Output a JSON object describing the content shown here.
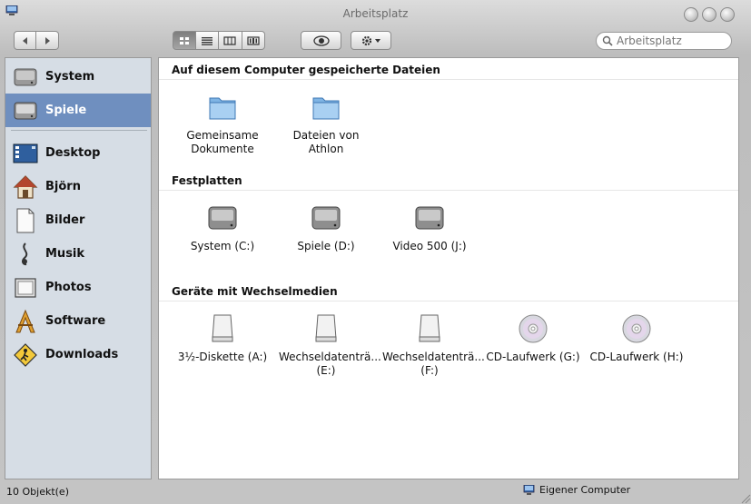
{
  "window": {
    "title": "Arbeitsplatz"
  },
  "toolbar": {
    "search_placeholder": "Arbeitsplatz"
  },
  "sidebar": {
    "items": [
      {
        "label": "System",
        "icon": "hard-drive-icon",
        "selected": false
      },
      {
        "label": "Spiele",
        "icon": "hard-drive-icon",
        "selected": true
      },
      {
        "label": "Desktop",
        "icon": "desktop-icon",
        "selected": false
      },
      {
        "label": "Björn",
        "icon": "home-icon",
        "selected": false
      },
      {
        "label": "Bilder",
        "icon": "pictures-icon",
        "selected": false
      },
      {
        "label": "Musik",
        "icon": "music-icon",
        "selected": false
      },
      {
        "label": "Photos",
        "icon": "photos-icon",
        "selected": false
      },
      {
        "label": "Software",
        "icon": "applications-icon",
        "selected": false
      },
      {
        "label": "Downloads",
        "icon": "downloads-icon",
        "selected": false
      }
    ]
  },
  "main": {
    "sections": [
      {
        "title": "Auf diesem Computer gespeicherte Dateien",
        "items": [
          {
            "label": "Gemeinsame Dokumente",
            "icon": "folder-icon"
          },
          {
            "label": "Dateien von Athlon",
            "icon": "folder-icon"
          }
        ]
      },
      {
        "title": "Festplatten",
        "items": [
          {
            "label": "System (C:)",
            "icon": "hard-drive-icon"
          },
          {
            "label": "Spiele (D:)",
            "icon": "hard-drive-icon"
          },
          {
            "label": "Video 500 (J:)",
            "icon": "hard-drive-icon"
          }
        ]
      },
      {
        "title": "Geräte mit Wechselmedien",
        "items": [
          {
            "label": "3½-Diskette (A:)",
            "icon": "removable-drive-icon"
          },
          {
            "label": "Wechseldatenträ... (E:)",
            "icon": "removable-drive-icon"
          },
          {
            "label": "Wechseldatenträ... (F:)",
            "icon": "removable-drive-icon"
          },
          {
            "label": "CD-Laufwerk (G:)",
            "icon": "cd-icon"
          },
          {
            "label": "CD-Laufwerk (H:)",
            "icon": "cd-icon"
          }
        ]
      }
    ]
  },
  "status": {
    "count": "10 Objekt(e)",
    "location": "Eigener Computer"
  }
}
